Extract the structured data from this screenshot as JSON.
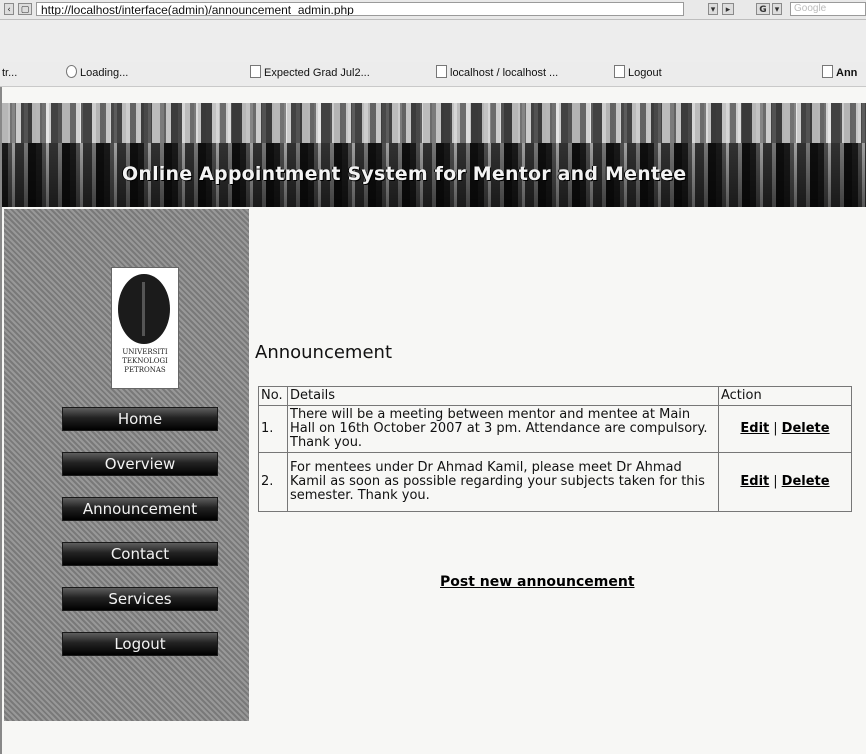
{
  "browser": {
    "address": "http://localhost/interface(admin)/announcement_admin.php",
    "search_placeholder": "Google",
    "bookmarks": [
      {
        "label": "tr..."
      },
      {
        "label": "Loading..."
      },
      {
        "label": "Expected Grad Jul2..."
      },
      {
        "label": "localhost / localhost ..."
      },
      {
        "label": "Logout"
      },
      {
        "label": "Ann"
      }
    ]
  },
  "header": {
    "title": "Online Appointment System for Mentor and Mentee"
  },
  "logo": {
    "text": "UNIVERSITI TEKNOLOGI PETRONAS"
  },
  "nav": {
    "items": [
      {
        "label": "Home"
      },
      {
        "label": "Overview"
      },
      {
        "label": "Announcement"
      },
      {
        "label": "Contact"
      },
      {
        "label": "Services"
      },
      {
        "label": "Logout"
      }
    ]
  },
  "main": {
    "heading": "Announcement",
    "table": {
      "headers": [
        "No.",
        "Details",
        "Action"
      ],
      "rows": [
        {
          "no": "1.",
          "details": "There will be a meeting between mentor and mentee at Main Hall on 16th October 2007 at 3 pm. Attendance are compulsory. Thank you.",
          "edit": "Edit",
          "separator": "|",
          "delete": "Delete"
        },
        {
          "no": "2.",
          "details": "For mentees under Dr Ahmad Kamil, please meet Dr Ahmad Kamil as soon as possible regarding your subjects taken for this semester. Thank you.",
          "edit": "Edit",
          "separator": "|",
          "delete": "Delete"
        }
      ]
    },
    "post_link": "Post new announcement"
  }
}
